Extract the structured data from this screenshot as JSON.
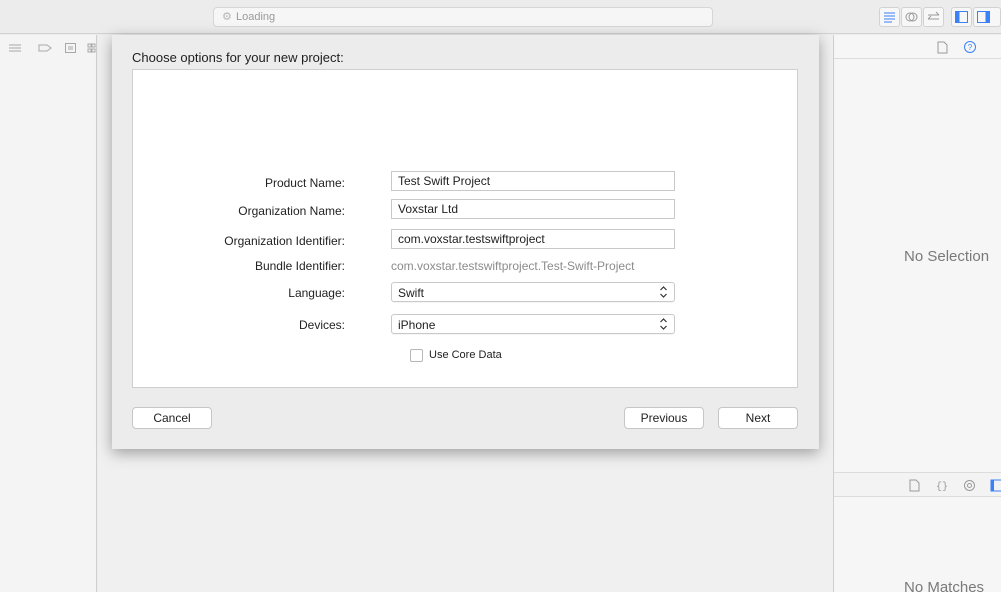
{
  "toolbar": {
    "activity_text": "Loading",
    "spinner_glyph": "⚙"
  },
  "sheet": {
    "title": "Choose options for your new project:",
    "fields": {
      "product_name": {
        "label": "Product Name:",
        "value": "Test Swift Project"
      },
      "organization_name": {
        "label": "Organization Name:",
        "value": "Voxstar Ltd"
      },
      "organization_identifier": {
        "label": "Organization Identifier:",
        "value": "com.voxstar.testswiftproject"
      },
      "bundle_identifier": {
        "label": "Bundle Identifier:",
        "value": "com.voxstar.testswiftproject.Test-Swift-Project"
      },
      "language": {
        "label": "Language:",
        "value": "Swift"
      },
      "devices": {
        "label": "Devices:",
        "value": "iPhone"
      }
    },
    "use_core_data": {
      "label": "Use Core Data",
      "checked": false
    },
    "buttons": {
      "cancel": "Cancel",
      "previous": "Previous",
      "next": "Next"
    }
  },
  "inspector": {
    "no_selection": "No Selection",
    "no_matches": "No Matches"
  },
  "colors": {
    "window_bg": "#ececec",
    "panel_bg": "#ffffff",
    "accent_blue": "#3b82f6"
  }
}
